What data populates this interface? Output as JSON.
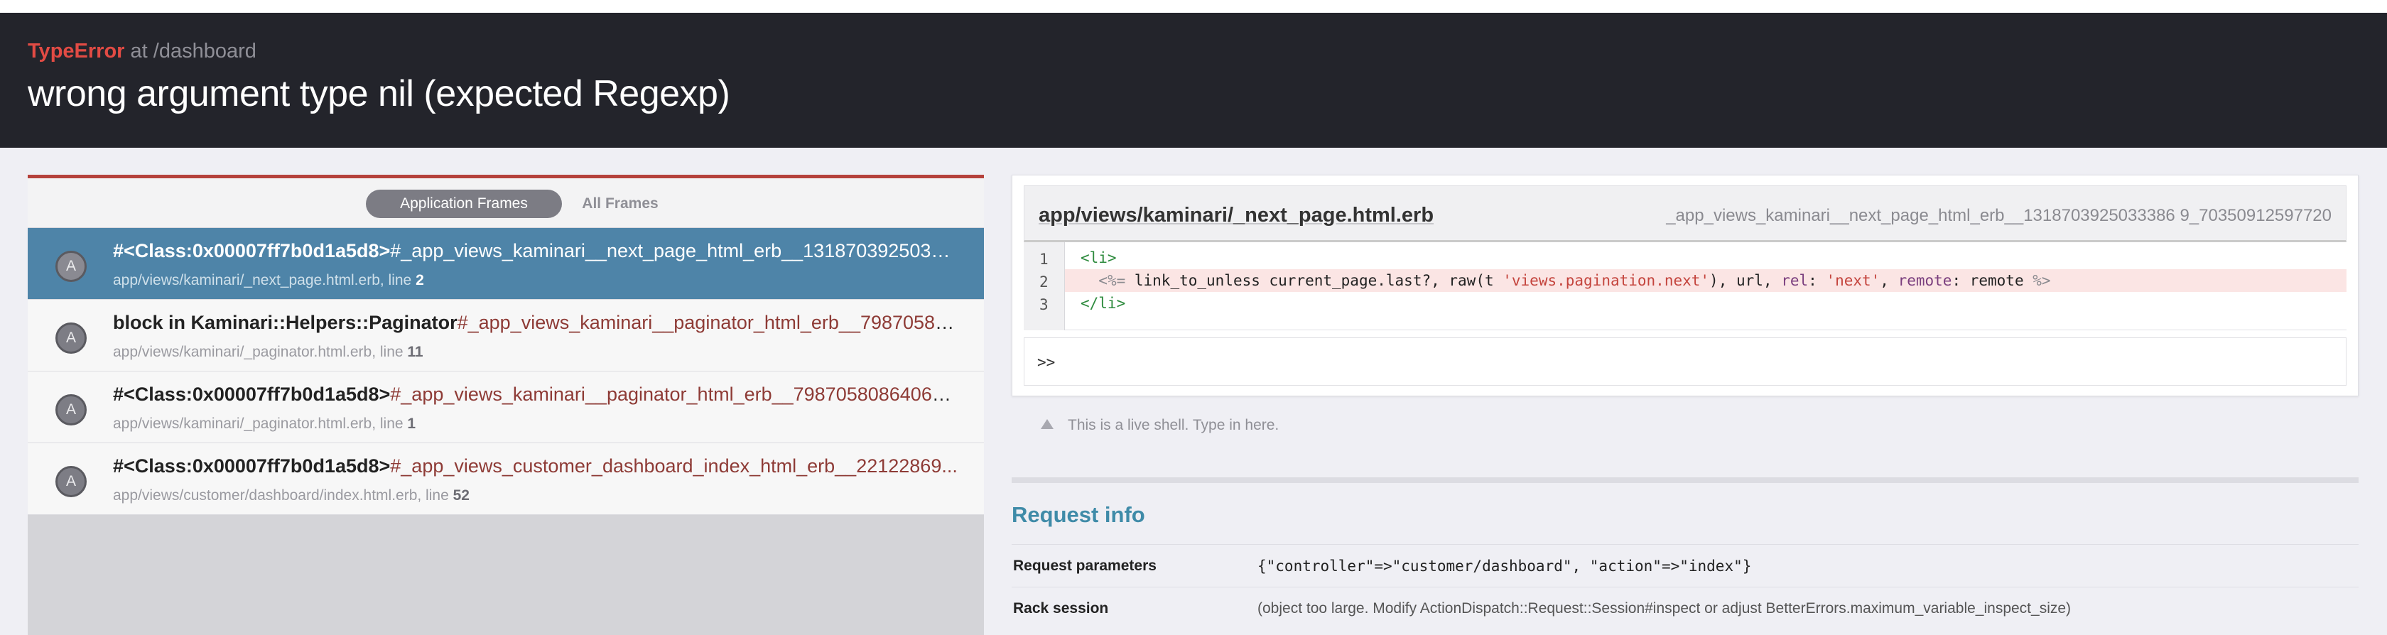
{
  "header": {
    "exception_class": "TypeError",
    "at_text": "at /dashboard",
    "message": "wrong argument type nil (expected Regexp)"
  },
  "frames_panel": {
    "tabs": [
      {
        "label": "Application Frames",
        "active": true
      },
      {
        "label": "All Frames",
        "active": false
      }
    ],
    "frames": [
      {
        "badge": "A",
        "context": "#<Class:0x00007ff7b0d1a5d8>",
        "method": "#_app_views_kaminari__next_page_html_erb__1318703925033386...",
        "file": "app/views/kaminari/_next_page.html.erb, line ",
        "line": "2",
        "selected": true
      },
      {
        "badge": "A",
        "context": "block in Kaminari::Helpers::Paginator",
        "method": "#_app_views_kaminari__paginator_html_erb__79870580...",
        "file": "app/views/kaminari/_paginator.html.erb, line ",
        "line": "11",
        "selected": false
      },
      {
        "badge": "A",
        "context": "#<Class:0x00007ff7b0d1a5d8>",
        "method": "#_app_views_kaminari__paginator_html_erb__79870580864061...",
        "file": "app/views/kaminari/_paginator.html.erb, line ",
        "line": "1",
        "selected": false
      },
      {
        "badge": "A",
        "context": "#<Class:0x00007ff7b0d1a5d8>",
        "method": "#_app_views_customer_dashboard_index_html_erb__22122869...",
        "file": "app/views/customer/dashboard/index.html.erb, line ",
        "line": "52",
        "selected": false
      }
    ]
  },
  "code": {
    "file": "app/views/kaminari/_next_page.html.erb",
    "method": "_app_views_kaminari__next_page_html_erb__1318703925033386 9_70350912597720",
    "line_numbers": [
      "1",
      "2",
      "3"
    ],
    "line1": "<li>",
    "line2": {
      "indent": "  ",
      "erb_open": "<%=",
      "code_a": " link_to_unless current_page.last?, raw(t ",
      "str1": "'views.pagination.next'",
      "code_b": "), url, ",
      "sym1": "rel",
      "code_c": ": ",
      "str2": "'next'",
      "code_d": ", ",
      "sym2": "remote",
      "code_e": ": remote ",
      "erb_close": "%>"
    },
    "line3": "</li>",
    "shell_prompt": ">>",
    "shell_hint": "This is a live shell. Type in here."
  },
  "request_info": {
    "title": "Request info",
    "rows": [
      {
        "key": "Request parameters",
        "value": "{\"controller\"=>\"customer/dashboard\", \"action\"=>\"index\"}"
      },
      {
        "key": "Rack session",
        "value": "(object too large. Modify ActionDispatch::Request::Session#inspect or adjust BetterErrors.maximum_variable_inspect_size)"
      }
    ]
  }
}
